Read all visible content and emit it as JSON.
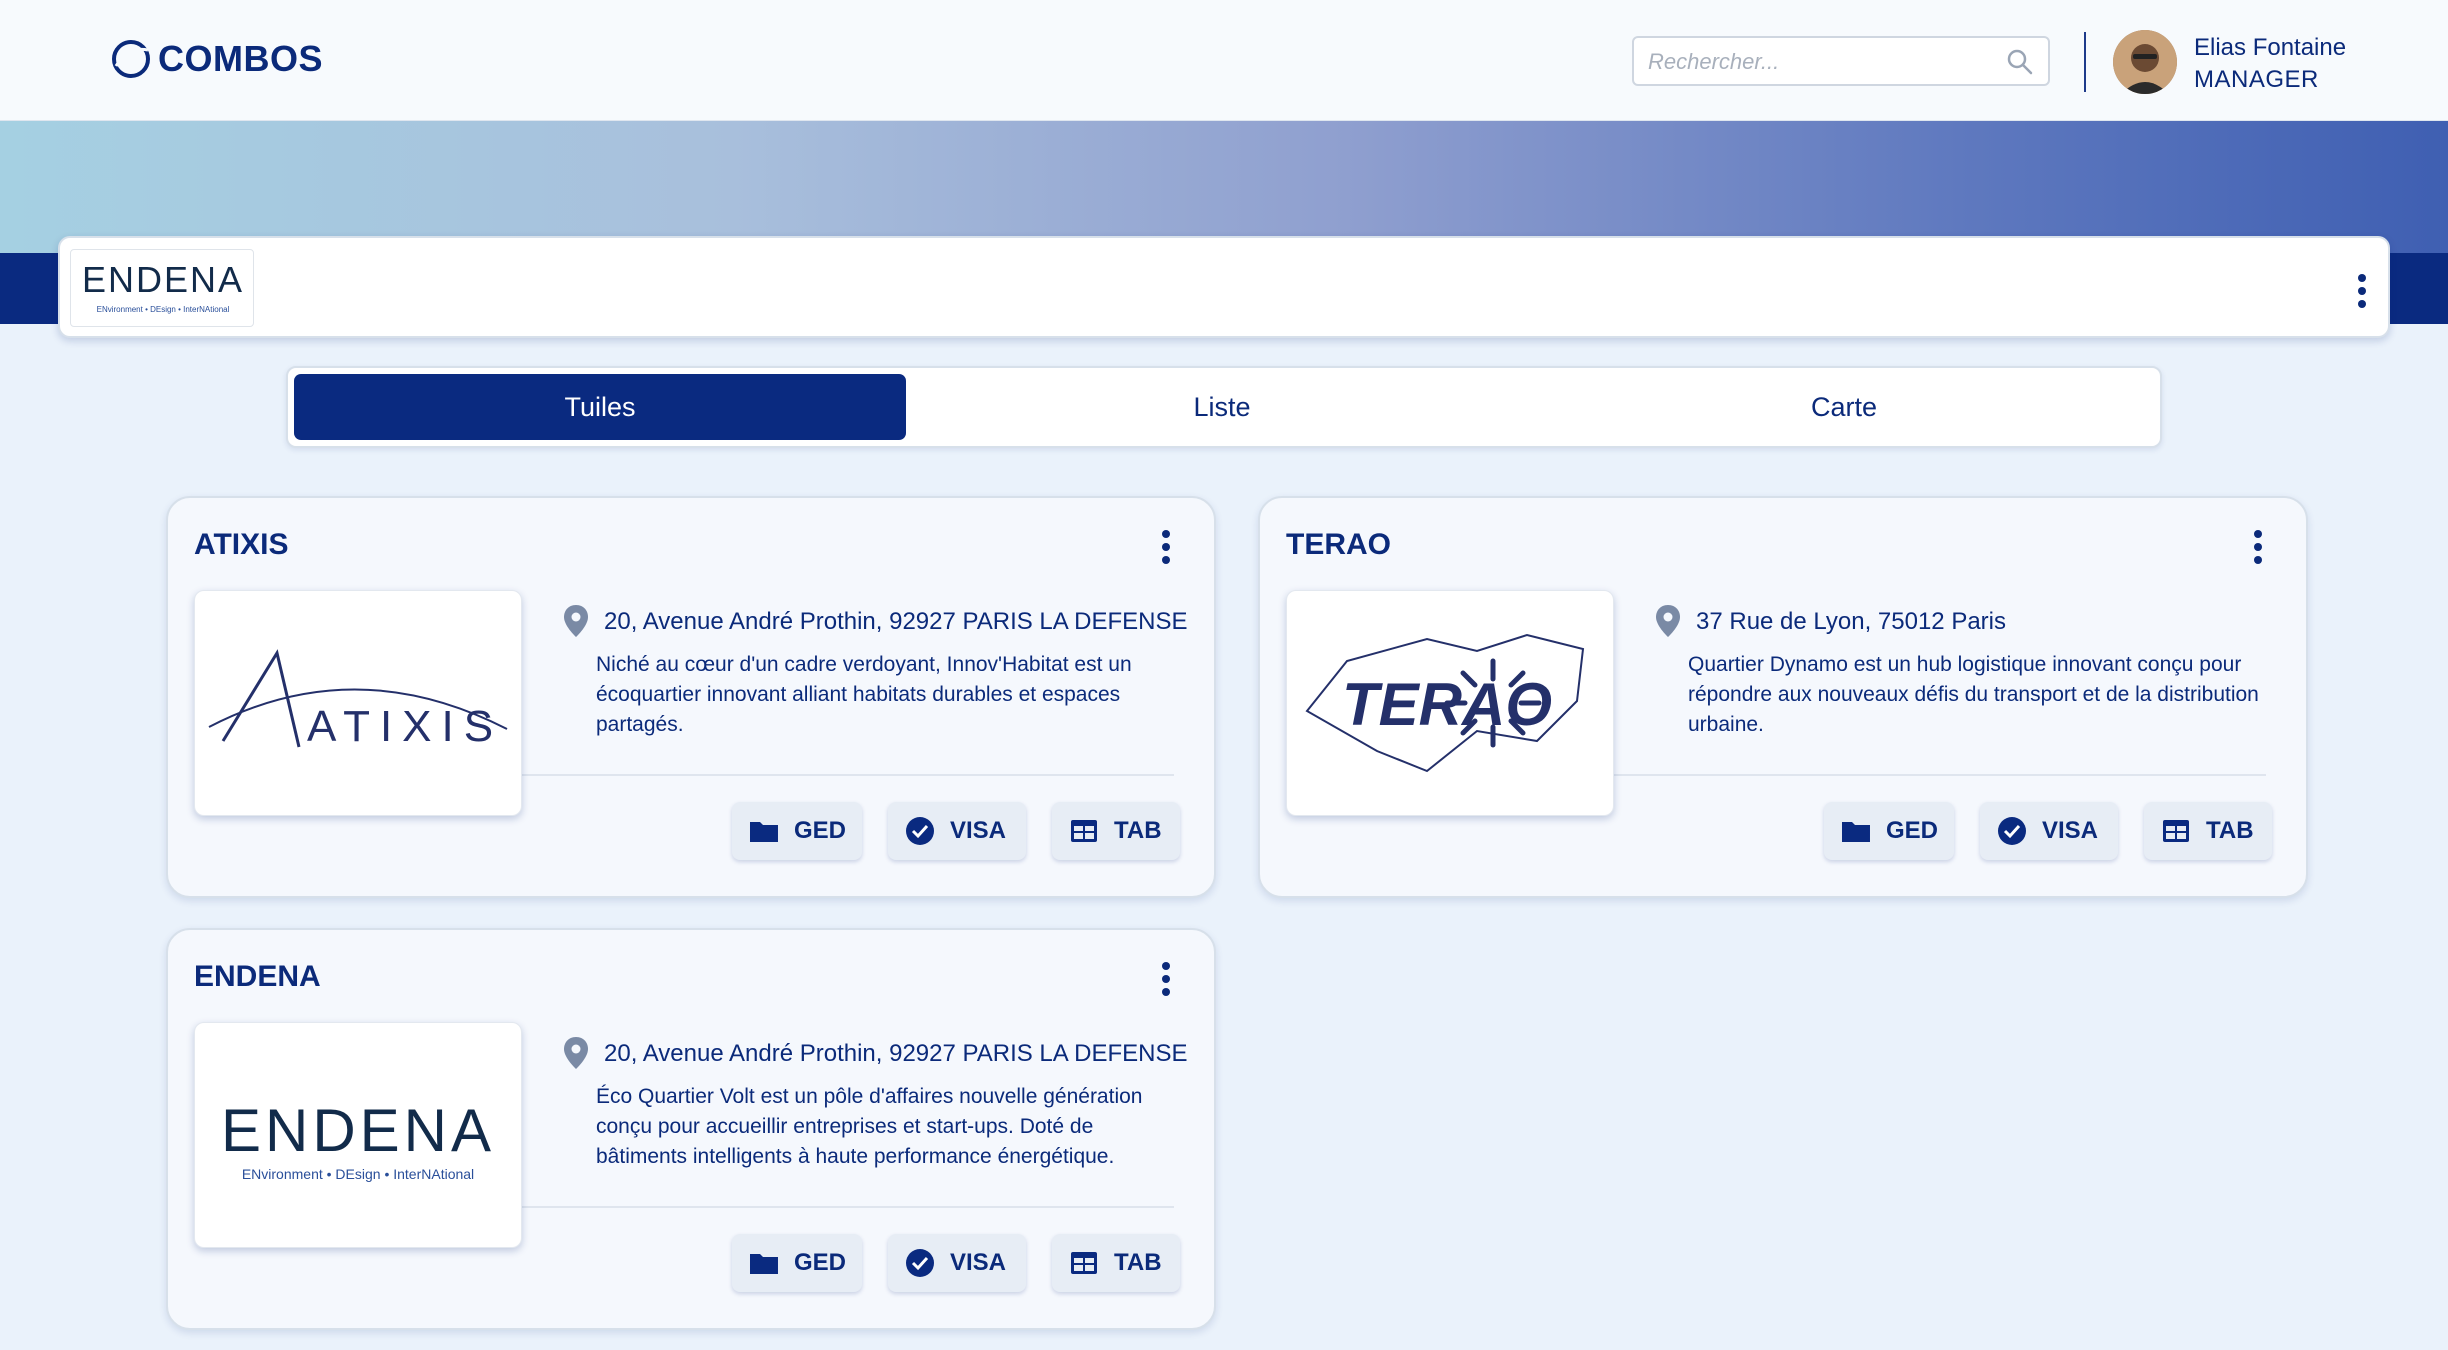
{
  "header": {
    "brand_name": "COMBOS",
    "search_placeholder": "Rechercher...",
    "user": {
      "name": "Elias Fontaine",
      "role": "MANAGER"
    }
  },
  "organization": {
    "logo_text": "ENDENA",
    "logo_tagline": "ENvironment • DEsign • InterNAtional"
  },
  "view_tabs": [
    {
      "label": "Tuiles",
      "active": true
    },
    {
      "label": "Liste",
      "active": false
    },
    {
      "label": "Carte",
      "active": false
    }
  ],
  "projects": [
    {
      "title": "ATIXIS",
      "logo_text": "ATIXIS",
      "address": "20, Avenue André Prothin, 92927 PARIS LA DEFENSE",
      "description": "Niché au cœur d'un cadre verdoyant, Innov'Habitat est un écoquartier innovant alliant habitats durables et espaces partagés.",
      "actions": [
        "GED",
        "VISA",
        "TAB"
      ]
    },
    {
      "title": "TERAO",
      "logo_text": "TERAO",
      "address": "37 Rue de Lyon, 75012 Paris",
      "description": "Quartier Dynamo est un hub logistique innovant conçu pour répondre aux nouveaux défis du transport et de la distribution urbaine.",
      "actions": [
        "GED",
        "VISA",
        "TAB"
      ]
    },
    {
      "title": "ENDENA",
      "logo_text": "ENDENA",
      "logo_tagline": "ENvironment • DEsign • InterNAtional",
      "address": "20, Avenue André Prothin, 92927 PARIS LA DEFENSE",
      "description": "Éco Quartier Volt est un pôle d'affaires nouvelle génération conçu pour accueillir entreprises et start-ups. Doté de bâtiments intelligents à haute performance énergétique.",
      "actions": [
        "GED",
        "VISA",
        "TAB"
      ]
    }
  ],
  "colors": {
    "primary": "#0a2a80",
    "text": "#0b2a7a",
    "background": "#eaf2fb",
    "pin": "#7a8aa5"
  },
  "icons": [
    "search-icon",
    "map-pin-icon",
    "folder-icon",
    "check-circle-icon",
    "table-icon",
    "kebab-menu-icon"
  ]
}
